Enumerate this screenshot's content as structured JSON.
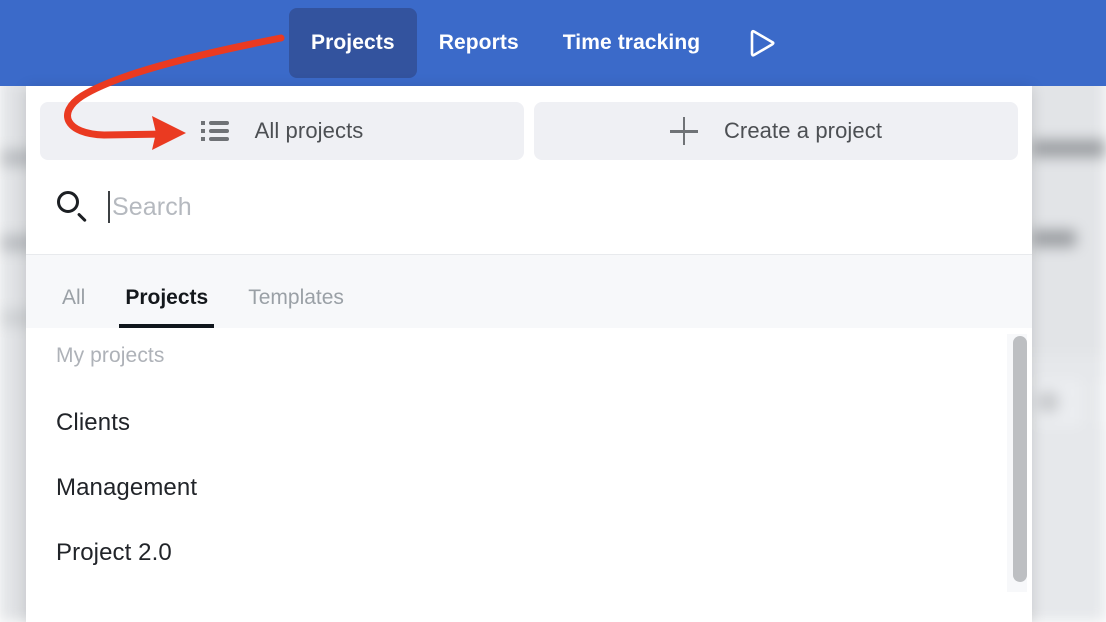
{
  "theme": {
    "navbar_blue": "#3b6ac9",
    "active_tab_blue": "#33539e",
    "button_gray": "#eff0f4",
    "annotation_red": "#ea3a21",
    "text_dark": "#212429",
    "text_muted": "#9aa0a6"
  },
  "navbar": {
    "items": [
      {
        "label": "Projects",
        "active": true
      },
      {
        "label": "Reports",
        "active": false
      },
      {
        "label": "Time tracking",
        "active": false
      }
    ],
    "timer_icon": "play-triangle-icon"
  },
  "modal": {
    "actions": [
      {
        "label": "All projects",
        "icon": "list-icon"
      },
      {
        "label": "Create a project",
        "icon": "plus-icon"
      }
    ],
    "search": {
      "icon": "search-icon",
      "value": "",
      "placeholder": "Search"
    },
    "tabs": [
      {
        "label": "All",
        "active": false
      },
      {
        "label": "Projects",
        "active": true
      },
      {
        "label": "Templates",
        "active": false
      }
    ],
    "list": {
      "group_title": "My projects",
      "items": [
        {
          "label": "Clients"
        },
        {
          "label": "Management"
        },
        {
          "label": "Project 2.0"
        }
      ]
    }
  },
  "annotation": {
    "type": "curved-arrow",
    "color": "#ea3a21",
    "points_to": "All projects list icon"
  }
}
